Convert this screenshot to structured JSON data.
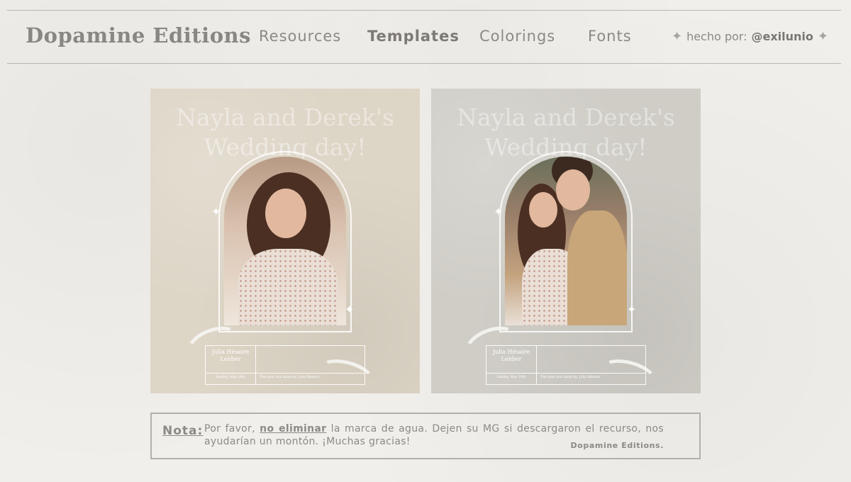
{
  "header": {
    "brand": "Dopamine Editions",
    "nav": [
      {
        "label": "Resources",
        "active": false
      },
      {
        "label": "Templates",
        "active": true
      },
      {
        "label": "Colorings",
        "active": false
      },
      {
        "label": "Fonts",
        "active": false
      }
    ],
    "credit_prefix": "hecho por:",
    "credit_handle": "@exilunio"
  },
  "templates": [
    {
      "title_line1": "Nayla and Derek's",
      "title_line2": "Wedding day!",
      "name": "Julia Hésaire Lenber",
      "date": "Sunday, May 18th",
      "footer": "This post was made by: Julia Hésaire",
      "background": "#ddd5c6"
    },
    {
      "title_line1": "Nayla and Derek's",
      "title_line2": "Wedding day!",
      "name": "Julia Hésaire Lenber",
      "date": "Sunday, May 18th",
      "footer": "This post was made by: Julia Hésaire",
      "background": "#cfcdc6"
    }
  ],
  "note": {
    "label": "Nota:",
    "text_before": "Por favor,",
    "text_emphasis": "no eliminar",
    "text_after": "la marca de agua. Dejen su MG si descargaron el recurso, nos ayudarían un montón. ¡Muchas gracias!",
    "signature": "Dopamine Editions."
  },
  "colors": {
    "background": "#f1efeb",
    "text": "#8d8a86",
    "border": "#b3b0ab"
  }
}
